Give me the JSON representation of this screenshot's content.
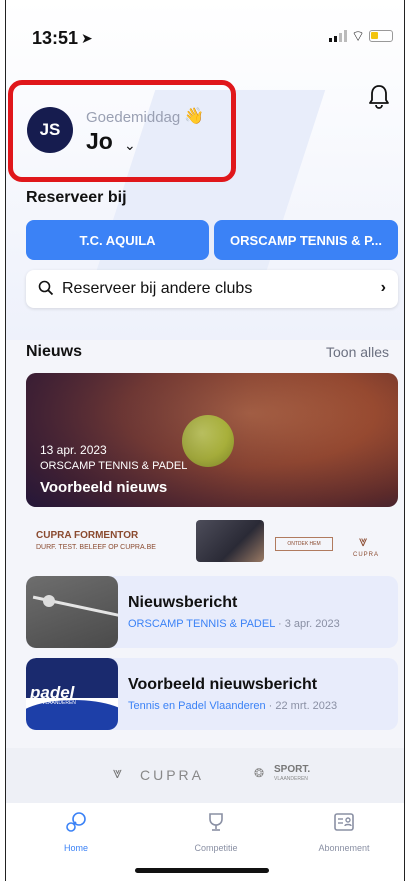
{
  "status_bar": {
    "time": "13:51"
  },
  "header": {
    "avatar_initials": "JS",
    "greeting": "Goedemiddag",
    "username": "Jo"
  },
  "reserve": {
    "section_title": "Reserveer bij",
    "clubs": [
      {
        "label": "T.C. AQUILA"
      },
      {
        "label": "ORSCAMP TENNIS & P..."
      }
    ],
    "search_label": "Reserveer bij andere clubs"
  },
  "news": {
    "section_title": "Nieuws",
    "see_all": "Toon alles",
    "featured": {
      "date": "13 apr. 2023",
      "club": "ORSCAMP TENNIS & PADEL",
      "title": "Voorbeeld nieuws"
    },
    "items": [
      {
        "title": "Nieuwsbericht",
        "source": "ORSCAMP TENNIS & PADEL",
        "date": "· 3 apr. 2023"
      },
      {
        "title": "Voorbeeld nieuwsbericht",
        "source": "Tennis en Padel Vlaanderen",
        "date": "· 22 mrt. 2023"
      }
    ]
  },
  "ad": {
    "title": "CUPRA FORMENTOR",
    "subtitle": "DURF. TEST. BELEEF OP CUPRA.BE",
    "cta": "ONTDEK HEM",
    "brand": "CUPRA"
  },
  "padel_logo": {
    "name": "padel",
    "sub": "VLAANDEREN"
  },
  "sponsors": {
    "cupra": "CUPRA",
    "sport": "SPORT.",
    "sport_sub": "VLAANDEREN"
  },
  "tabbar": {
    "tabs": [
      {
        "label": "Home",
        "icon": "tennis-icon",
        "active": true
      },
      {
        "label": "Competitie",
        "icon": "trophy-icon",
        "active": false
      },
      {
        "label": "Abonnement",
        "icon": "member-card-icon",
        "active": false
      }
    ]
  },
  "colors": {
    "accent": "#3b82f6",
    "avatar_bg": "#161c4f",
    "highlight_border": "#e0171b",
    "card_bg": "#e8ecfb"
  }
}
